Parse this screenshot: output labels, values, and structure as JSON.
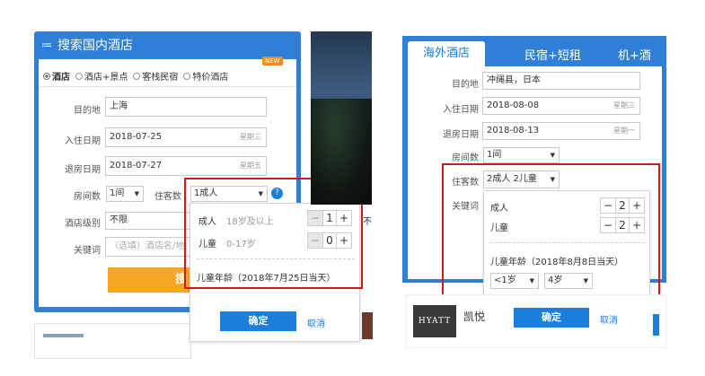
{
  "left": {
    "title": "搜索国内酒店",
    "types": [
      "酒店",
      "酒店+景点",
      "客栈民宿",
      "特价酒店"
    ],
    "new_badge": "NEW",
    "fields": {
      "dest_label": "目的地",
      "dest_value": "上海",
      "checkin_label": "入住日期",
      "checkin_value": "2018-07-25",
      "checkin_week": "星期三",
      "checkout_label": "退房日期",
      "checkout_value": "2018-07-27",
      "checkout_week": "星期五",
      "rooms_label": "房间数",
      "rooms_value": "1间",
      "guests_label": "住客数",
      "guests_value": "1成人",
      "star_label": "酒店级别",
      "star_value": "不限",
      "keyword_label": "关键词",
      "keyword_placeholder": "（选填）酒店名/地"
    },
    "search_button_partial": "搜",
    "overflow_text": "不",
    "popup": {
      "adults_label": "成人",
      "adults_hint": "18岁及以上",
      "adults_count": "1",
      "children_label": "儿童",
      "children_hint": "0-17岁",
      "children_count": "0",
      "age_note": "儿童年龄（2018年7月25日当天）",
      "confirm": "确定",
      "cancel": "取消"
    },
    "help_icon": "question-icon"
  },
  "right": {
    "tabs": [
      "海外酒店",
      "民宿+短租",
      "机+酒"
    ],
    "fields": {
      "dest_label": "目的地",
      "dest_value": "冲绳县，日本",
      "checkin_label": "入住日期",
      "checkin_value": "2018-08-08",
      "checkin_week": "星期三",
      "checkout_label": "退房日期",
      "checkout_value": "2018-08-13",
      "checkout_week": "星期一",
      "rooms_label": "房间数",
      "rooms_value": "1间",
      "guests_label": "住客数",
      "guests_value": "2成人 2儿童",
      "keyword_label": "关键词"
    },
    "popup": {
      "adults_label": "成人",
      "adults_count": "2",
      "children_label": "儿童",
      "children_count": "2",
      "age_note": "儿童年龄（2018年8月8日当天）",
      "age1": "<1岁",
      "age2": "4岁",
      "confirm": "确定",
      "cancel": "取消"
    },
    "hotel_logo": "HYATT",
    "hotel_name_partial": "凯悦"
  },
  "colors": {
    "primary": "#1a7fdb",
    "highlight": "#cc1b1b",
    "search": "#f5a623"
  }
}
